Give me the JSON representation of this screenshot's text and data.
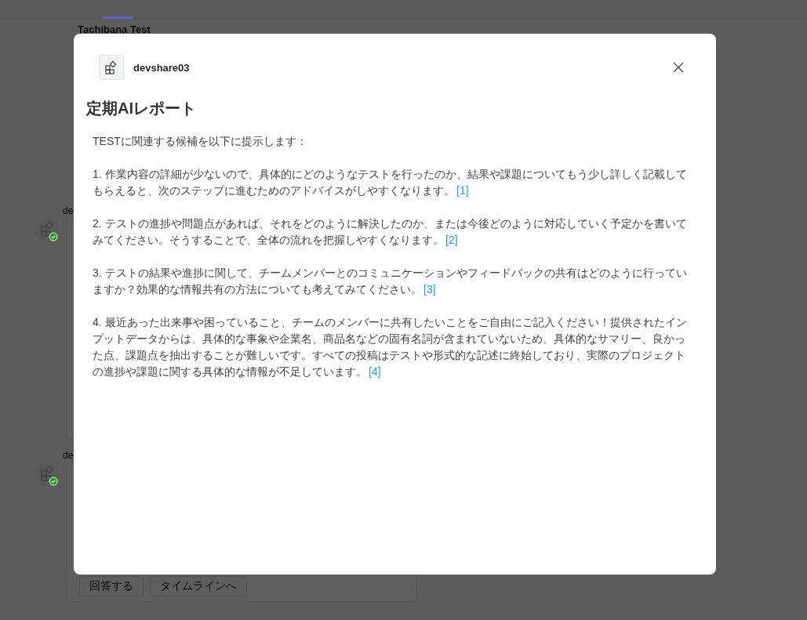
{
  "background": {
    "channel_title": "Tachibana Test",
    "posts": [
      {
        "author": "de"
      },
      {
        "author": "de",
        "buttons": [
          "回答する",
          "タイムラインへ"
        ]
      }
    ]
  },
  "dialog": {
    "app_name": "devshare03",
    "title": "定期AIレポート",
    "intro": "TESTに関連する候補を以下に提示します：",
    "items": [
      {
        "text": "1. 作業内容の詳細が少ないので、具体的にどのようなテストを行ったのか、結果や課題についてもう少し詳しく記載してもらえると、次のステップに進むためのアドバイスがしやすくなります。",
        "citation": "[1]"
      },
      {
        "text": "2. テストの進捗や問題点があれば、それをどのように解決したのか、または今後どのように対応していく予定かを書いてみてください。そうすることで、全体の流れを把握しやすくなります。",
        "citation": "[2]"
      },
      {
        "text": "3. テストの結果や進捗に関して、チームメンバーとのコミュニケーションやフィードバックの共有はどのように行っていますか？効果的な情報共有の方法についても考えてみてください。",
        "citation": "[3]"
      },
      {
        "text": "4. 最近あった出来事や困っていること、チームのメンバーに共有したいことをご自由にご記入ください！提供されたインプットデータからは、具体的な事象や企業名、商品名などの固有名詞が含まれていないため、具体的なサマリー、良かった点、課題点を抽出することが難しいです。すべての投稿はテストや形式的な記述に終始しており、実際のプロジェクトの進捗や課題に関する具体的な情報が不足しています。",
        "citation": "[4]"
      }
    ]
  }
}
